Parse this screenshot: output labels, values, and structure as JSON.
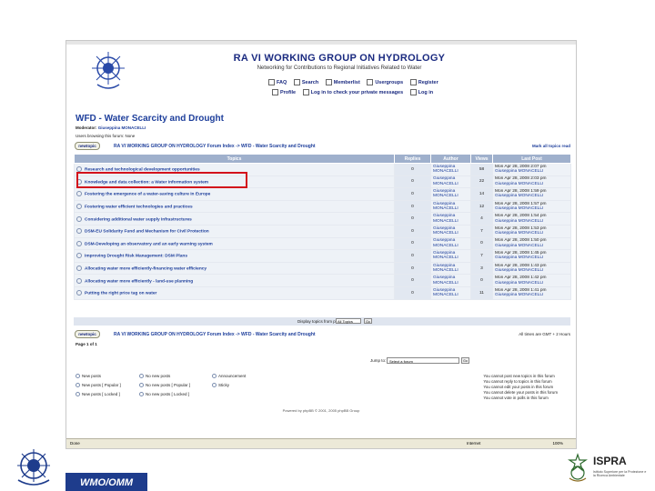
{
  "banner": {
    "title": "RA VI WORKING GROUP ON HYDROLOGY",
    "subtitle": "Networking for Contributions to Regional Initiatives Related to Water",
    "nav_row1": [
      "FAQ",
      "Search",
      "Memberlist",
      "Usergroups",
      "Register"
    ],
    "nav_row2": [
      "Profile",
      "Log in to check your private messages",
      "Log in"
    ]
  },
  "forum": {
    "title": "WFD - Water Scarcity and Drought",
    "moderator_label": "Moderator:",
    "moderator_name": "Giuseppina MONACELLI",
    "browsing": "Users browsing this forum: None",
    "newtopic_label": "newtopic",
    "breadcrumb": "RA VI WORKING GROUP ON HYDROLOGY Forum Index -> WFD - Water Scarcity and Drought",
    "mark_read": "Mark all topics read"
  },
  "table": {
    "headers": [
      "Topics",
      "Replies",
      "Author",
      "Views",
      "Last Post"
    ],
    "rows": [
      {
        "topic": "Research and technological development opportunities",
        "replies": "0",
        "author": "Giuseppina MONACELLI",
        "views": "58",
        "date": "Mon Apr 28, 2008 2:07 pm",
        "last": "Giuseppina MONACELLI"
      },
      {
        "topic": "Knowledge and data collection: a Water information system",
        "replies": "0",
        "author": "Giuseppina MONACELLI",
        "views": "22",
        "date": "Mon Apr 28, 2008 2:03 pm",
        "last": "Giuseppina MONACELLI"
      },
      {
        "topic": "Fostering the emergence of a water-saving culture in Europe",
        "replies": "0",
        "author": "Giuseppina MONACELLI",
        "views": "14",
        "date": "Mon Apr 28, 2008 1:59 pm",
        "last": "Giuseppina MONACELLI"
      },
      {
        "topic": "Fostering water efficient technologies and practices",
        "replies": "0",
        "author": "Giuseppina MONACELLI",
        "views": "12",
        "date": "Mon Apr 28, 2008 1:57 pm",
        "last": "Giuseppina MONACELLI"
      },
      {
        "topic": "Considering additional water supply infrastructures",
        "replies": "0",
        "author": "Giuseppina MONACELLI",
        "views": "4",
        "date": "Mon Apr 28, 2008 1:54 pm",
        "last": "Giuseppina MONACELLI"
      },
      {
        "topic": "DSM-EU Solidarity Fund and Mechanism for Civil Protection",
        "replies": "0",
        "author": "Giuseppina MONACELLI",
        "views": "7",
        "date": "Mon Apr 28, 2008 1:53 pm",
        "last": "Giuseppina MONACELLI"
      },
      {
        "topic": "DSM-Developing an observatory and an early warning system",
        "replies": "0",
        "author": "Giuseppina MONACELLI",
        "views": "0",
        "date": "Mon Apr 28, 2008 1:50 pm",
        "last": "Giuseppina MONACELLI"
      },
      {
        "topic": "Improving Drought Risk Management: DSM Plans",
        "replies": "0",
        "author": "Giuseppina MONACELLI",
        "views": "7",
        "date": "Mon Apr 28, 2008 1:45 pm",
        "last": "Giuseppina MONACELLI"
      },
      {
        "topic": "Allocating water more efficiently-financing water efficiency",
        "replies": "0",
        "author": "Giuseppina MONACELLI",
        "views": "3",
        "date": "Mon Apr 28, 2008 1:43 pm",
        "last": "Giuseppina MONACELLI"
      },
      {
        "topic": "Allocating water more efficiently - land-use planning",
        "replies": "0",
        "author": "Giuseppina MONACELLI",
        "views": "0",
        "date": "Mon Apr 28, 2008 1:42 pm",
        "last": "Giuseppina MONACELLI"
      },
      {
        "topic": "Putting the right price tag on water",
        "replies": "0",
        "author": "Giuseppina MONACELLI",
        "views": "11",
        "date": "Mon Apr 28, 2008 1:41 pm",
        "last": "Giuseppina MONACELLI"
      }
    ]
  },
  "filter": {
    "label": "Display topics from previous:",
    "select": "All Topics",
    "go": "Go"
  },
  "footer": {
    "page": "Page 1 of 1",
    "timezone": "All times are GMT + 2 Hours",
    "jump_label": "Jump to:",
    "jump_select": "Select a forum",
    "jump_go": "Go",
    "legend": [
      [
        "New posts",
        "No new posts",
        "Announcement"
      ],
      [
        "New posts [ Popular ]",
        "No new posts [ Popular ]",
        "Sticky"
      ],
      [
        "New posts [ Locked ]",
        "No new posts [ Locked ]",
        ""
      ]
    ],
    "permissions": [
      "You cannot post new topics in this forum",
      "You cannot reply to topics in this forum",
      "You cannot edit your posts in this forum",
      "You cannot delete your posts in this forum",
      "You cannot vote in polls in this forum"
    ],
    "powered": "Powered by phpBB © 2001, 2005 phpBB Group"
  },
  "statusbar": {
    "done": "Done",
    "zone": "Internet",
    "zoom": "100%"
  },
  "slide": {
    "wmo_caption": "WMO/OMM",
    "ispra_name": "ISPRA",
    "ispra_sub": "Istituto Superiore per la Protezione e la Ricerca Ambientale"
  },
  "colors": {
    "header_blue": "#1d3e9b",
    "table_header": "#9fb0cc",
    "highlight_red": "#d3121b",
    "wmo_blue": "#1e3c8c"
  }
}
